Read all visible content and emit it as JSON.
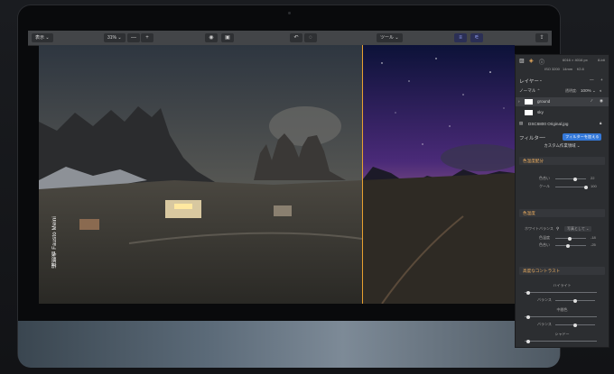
{
  "toolbar": {
    "view_label": "表示",
    "zoom_value": "31%",
    "zoom_minus": "—",
    "zoom_plus": "+",
    "tools_label": "ツール"
  },
  "info": {
    "dimensions": "6016 × 4016 px",
    "bit_depth": "8-bit",
    "iso": "ISO 3200",
    "focal": "14mm",
    "aperture": "f/2.8"
  },
  "layers": {
    "title": "レイヤー",
    "blend_mode": "ノーマル",
    "opacity_label": "透明度:",
    "opacity_value": "100%",
    "items": [
      {
        "name": "ground"
      },
      {
        "name": "sky"
      },
      {
        "name": "DSC6800 Original.jpg"
      }
    ]
  },
  "filters": {
    "title": "フィルター",
    "add_button": "フィルターを加える",
    "workspace": "カスタム作業領域"
  },
  "sections": [
    {
      "title": "色温度配分",
      "sliders": [
        {
          "label": "色合い",
          "value": "22"
        },
        {
          "label": "クール",
          "value": "100"
        }
      ]
    },
    {
      "title": "色温度",
      "white_balance_label": "ホワイトバランス",
      "white_balance_value": "写真として",
      "sliders": [
        {
          "label": "色温度",
          "value": "-18"
        },
        {
          "label": "色合い",
          "value": "-25"
        }
      ]
    },
    {
      "title": "高度なコントラスト",
      "groups": [
        {
          "name": "ハイライト",
          "balance": "バランス"
        },
        {
          "name": "中間色",
          "balance": "バランス"
        },
        {
          "name": "シャドー"
        }
      ]
    }
  ],
  "photo_credit": "撮影者 Fausto Meini",
  "colors": {
    "accent": "#3478d8",
    "split": "#e8a030",
    "section": "#f0b060"
  }
}
